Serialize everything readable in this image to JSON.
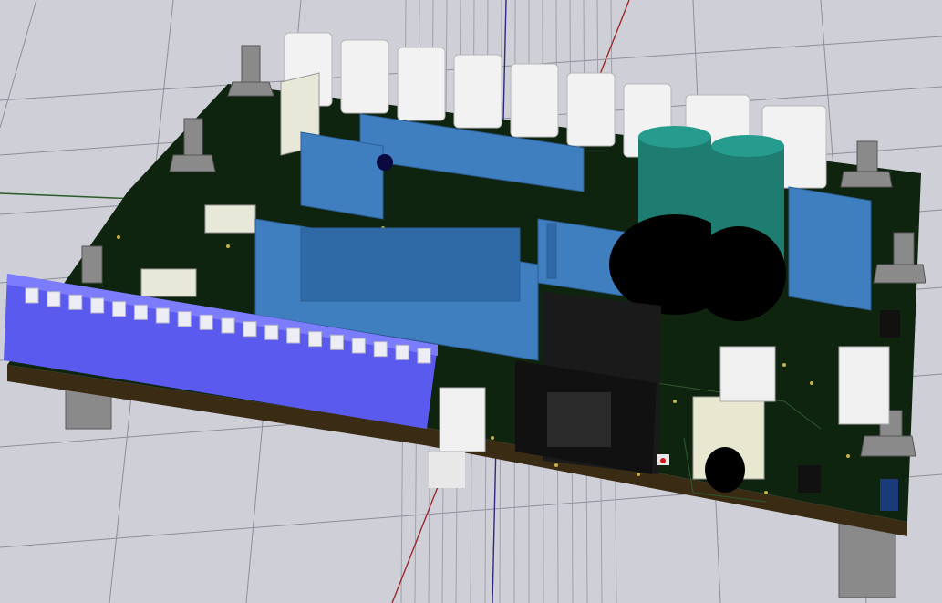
{
  "viewer": {
    "background_color": "#cfcfd8",
    "grid_color": "#8c8c96",
    "x_axis_color": "#9b2a2a",
    "y_axis_color": "#2a5a2a",
    "z_axis_color": "#2a2a7a"
  },
  "board": {
    "pcb_color": "#0f240f",
    "edge_color": "#3a2c14",
    "silkscreen_color": "#d8d8c8"
  },
  "components": {
    "dip_switch": {
      "positions": 19,
      "color": "#5a5aee"
    },
    "box_headers": {
      "color": "#3f7fbf"
    },
    "electrolytic_caps": {
      "count": 2,
      "color": "#1e7c70"
    },
    "white_connectors_top": {
      "count": 10,
      "color": "#f2f2f2"
    },
    "standoffs": {
      "color": "#8a8a8a"
    },
    "rj_jack": {
      "color": "#141414"
    }
  }
}
